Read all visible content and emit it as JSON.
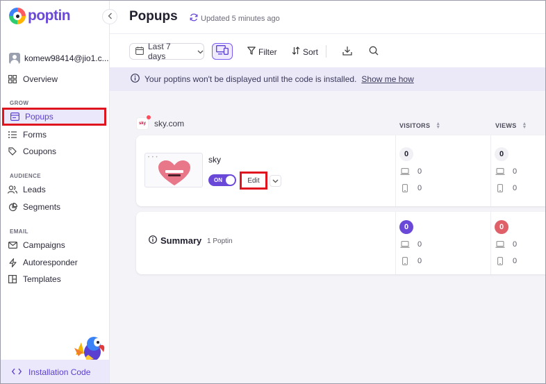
{
  "brand": {
    "name": "poptin",
    "accent": "#6a49d8"
  },
  "account": {
    "email": "komew98414@jio1.c..."
  },
  "sidebar": {
    "items_top": [
      {
        "label": "Overview",
        "icon": "grid-icon"
      }
    ],
    "sections": [
      {
        "heading": "GROW",
        "items": [
          {
            "label": "Popups",
            "icon": "popup-window-icon",
            "active": true
          },
          {
            "label": "Forms",
            "icon": "list-icon"
          },
          {
            "label": "Coupons",
            "icon": "tag-icon"
          }
        ]
      },
      {
        "heading": "AUDIENCE",
        "items": [
          {
            "label": "Leads",
            "icon": "users-icon"
          },
          {
            "label": "Segments",
            "icon": "pie-chart-icon"
          }
        ]
      },
      {
        "heading": "EMAIL",
        "items": [
          {
            "label": "Campaigns",
            "icon": "mail-icon"
          },
          {
            "label": "Autoresponder",
            "icon": "bolt-icon"
          },
          {
            "label": "Templates",
            "icon": "layout-icon"
          }
        ]
      }
    ],
    "install_label": "Installation Code"
  },
  "header": {
    "title": "Popups",
    "updated": "Updated 5 minutes ago"
  },
  "toolbar": {
    "date_range": "Last 7 days",
    "filter": "Filter",
    "sort": "Sort"
  },
  "banner": {
    "text": "Your poptins won't be displayed until the code is installed.",
    "link": "Show me how"
  },
  "site": {
    "name": "sky.com",
    "logo_text": "sky"
  },
  "columns": [
    "VISITORS",
    "VIEWS"
  ],
  "popup": {
    "name": "sky",
    "toggle": "ON",
    "edit": "Edit",
    "visitors": {
      "total": "0",
      "desktop": "0",
      "mobile": "0"
    },
    "views": {
      "total": "0",
      "desktop": "0",
      "mobile": "0"
    }
  },
  "summary": {
    "title": "Summary",
    "count": "1 Poptin",
    "visitors": {
      "total": "0",
      "desktop": "0",
      "mobile": "0"
    },
    "views": {
      "total": "0",
      "desktop": "0",
      "mobile": "0"
    }
  }
}
